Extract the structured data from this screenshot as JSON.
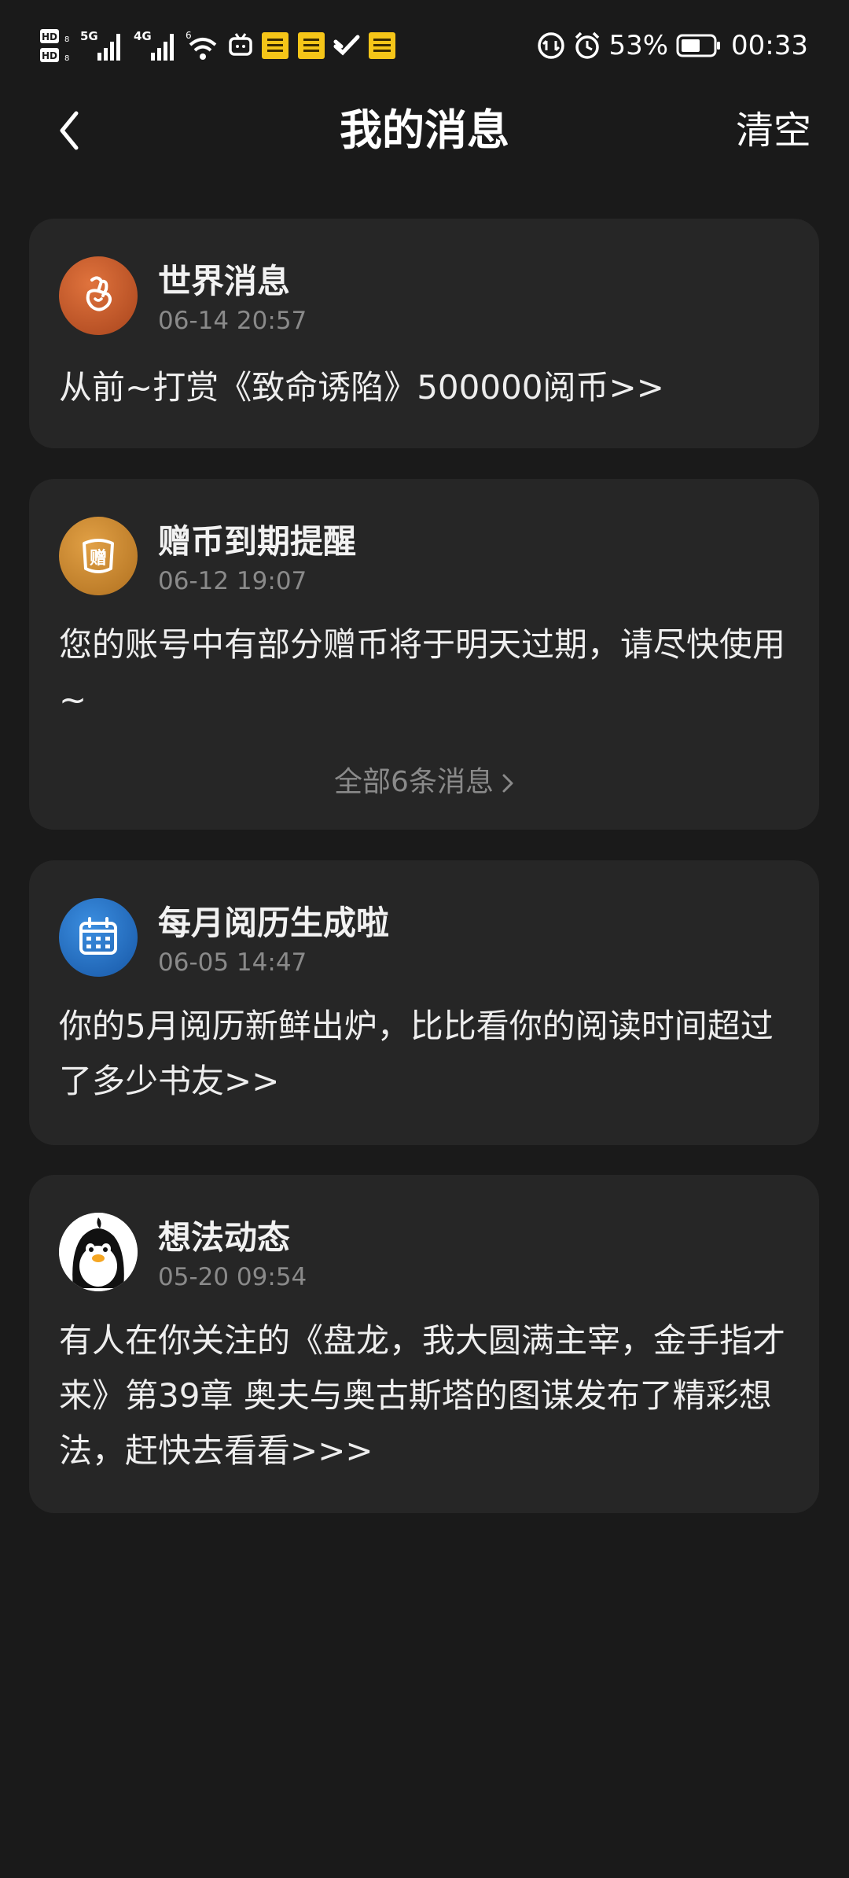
{
  "status_bar": {
    "battery_percent": "53%",
    "time": "00:33",
    "icons": [
      "hd-icon",
      "5g-signal-icon",
      "4g-signal-icon",
      "wifi-icon",
      "tv-app-icon",
      "app-badge-icon",
      "app-badge-icon",
      "app-swoosh-icon",
      "app-badge-icon",
      "data-saver-icon",
      "alarm-icon",
      "battery-icon"
    ]
  },
  "nav": {
    "title": "我的消息",
    "clear_label": "清空"
  },
  "messages": [
    {
      "title": "世界消息",
      "time": "06-14 20:57",
      "body": "从前~打赏《致命诱陷》500000阅币>>",
      "icon": "hand-gesture-icon",
      "icon_color": "#c9592a"
    },
    {
      "title": "赠币到期提醒",
      "time": "06-12 19:07",
      "body": "您的账号中有部分赠币将于明天过期，请尽快使用~",
      "more_label": "全部6条消息",
      "icon": "gift-coin-icon",
      "icon_color": "#c9852e"
    },
    {
      "title": "每月阅历生成啦",
      "time": "06-05 14:47",
      "body": "你的5月阅历新鲜出炉，比比看你的阅读时间超过了多少书友>>",
      "icon": "calendar-icon",
      "icon_color": "#1f6fc4"
    },
    {
      "title": "想法动态",
      "time": "05-20 09:54",
      "body": "有人在你关注的《盘龙，我大圆满主宰，金手指才来》第39章 奥夫与奥古斯塔的图谋发布了精彩想法，赶快去看看>>>",
      "icon": "penguin-avatar-icon",
      "icon_color": "#ffffff"
    }
  ]
}
